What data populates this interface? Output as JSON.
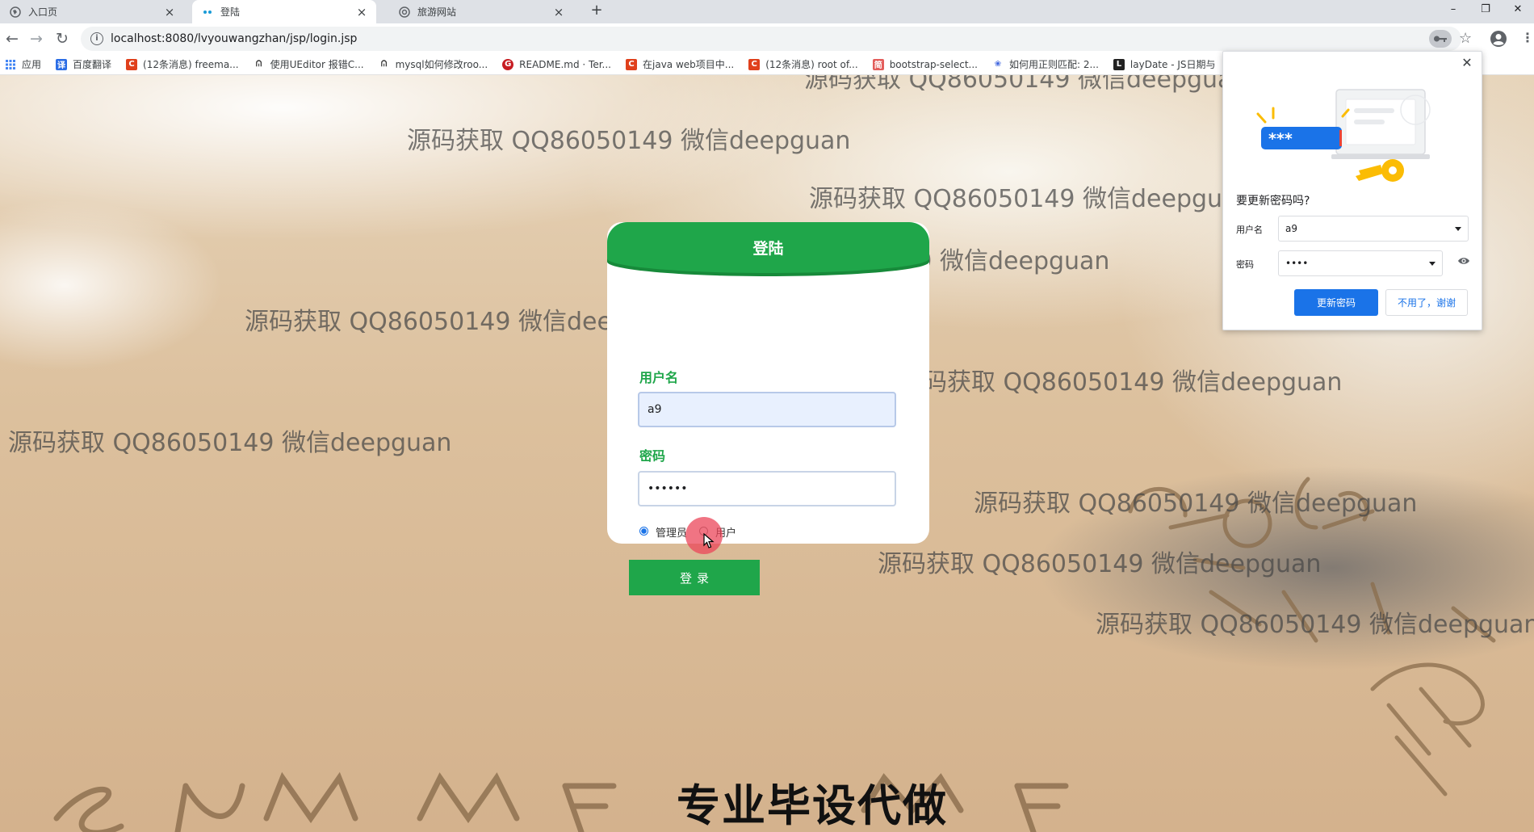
{
  "browser": {
    "tabs": [
      {
        "title": "入口页",
        "favicon": "globe-icon",
        "active": false
      },
      {
        "title": "登陆",
        "favicon": "dots-icon",
        "active": true
      },
      {
        "title": "旅游网站",
        "favicon": "settings-circle-icon",
        "active": false
      }
    ],
    "close_glyph": "×",
    "new_tab_glyph": "+",
    "window_controls": {
      "minimize": "–",
      "restore": "❐",
      "close": "✕"
    },
    "url": "localhost:8080/lvyouwangzhan/jsp/login.jsp",
    "nav": {
      "back": "←",
      "forward": "→",
      "reload": "↻"
    },
    "star_glyph": "☆",
    "menu_glyph": "⋮"
  },
  "bookmarks": [
    {
      "label": "应用",
      "icon": "apps-grid-icon",
      "color": "#4285f4"
    },
    {
      "label": "百度翻译",
      "icon": "baidu-translate-icon",
      "color": "#2b6de5"
    },
    {
      "label": "(12条消息) freema...",
      "icon": "csdn-icon",
      "color": "#e0401c"
    },
    {
      "label": "使用UEditor 报错C...",
      "icon": "yuque-icon",
      "color": "#333333"
    },
    {
      "label": "mysql如何修改roo...",
      "icon": "yuque-icon",
      "color": "#333333"
    },
    {
      "label": "README.md · Ter...",
      "icon": "gitee-icon",
      "color": "#c71d23"
    },
    {
      "label": "在java web项目中...",
      "icon": "csdn-icon",
      "color": "#e0401c"
    },
    {
      "label": "(12条消息) root of...",
      "icon": "csdn-icon",
      "color": "#e0401c"
    },
    {
      "label": "bootstrap-select...",
      "icon": "bootstrap-icon",
      "color": "#e35d5b"
    },
    {
      "label": "如何用正则匹配: 2...",
      "icon": "paw-icon",
      "color": "#3e64de"
    },
    {
      "label": "layDate - JS日期与",
      "icon": "laydate-icon",
      "color": "#222222"
    }
  ],
  "watermark_text": "源码获取 QQ86050149 微信deepguan",
  "big_watermark": "专业毕设代做",
  "login": {
    "title": "登陆",
    "username_label": "用户名",
    "username_value": "a9",
    "password_label": "密码",
    "password_value": "••••••",
    "roles": [
      {
        "label": "管理员",
        "checked": true
      },
      {
        "label": "用户",
        "checked": false
      }
    ],
    "submit_label": "登录",
    "accent": "#1fa64a"
  },
  "password_popup": {
    "title": "要更新密码吗?",
    "username_label": "用户名",
    "username_value": "a9",
    "password_label": "密码",
    "password_value": "••••",
    "illustration_text": "***",
    "update_button": "更新密码",
    "dismiss_button": "不用了，谢谢",
    "close_glyph": "✕",
    "accent": "#1a73e8"
  }
}
